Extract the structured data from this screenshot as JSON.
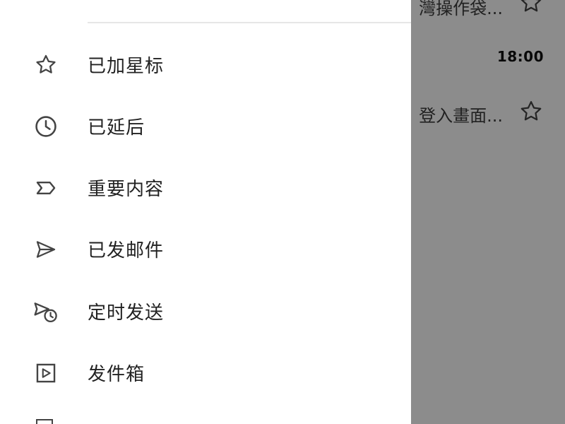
{
  "background_list": {
    "rows": [
      {
        "snippet": "灣操作袋...",
        "time": ""
      },
      {
        "snippet": "",
        "time": "18:00"
      },
      {
        "snippet": "登入畫面...",
        "time": ""
      }
    ]
  },
  "drawer": {
    "items": [
      {
        "label": "已加星标",
        "icon": "star-icon"
      },
      {
        "label": "已延后",
        "icon": "clock-icon"
      },
      {
        "label": "重要内容",
        "icon": "important-label-icon"
      },
      {
        "label": "已发邮件",
        "icon": "send-icon"
      },
      {
        "label": "定时发送",
        "icon": "scheduled-send-icon"
      },
      {
        "label": "发件箱",
        "icon": "outbox-icon"
      }
    ]
  },
  "colors": {
    "scrim": "#8a8a8a",
    "drawer_bg": "#ffffff",
    "text": "#222222",
    "icon_stroke": "#444444"
  }
}
